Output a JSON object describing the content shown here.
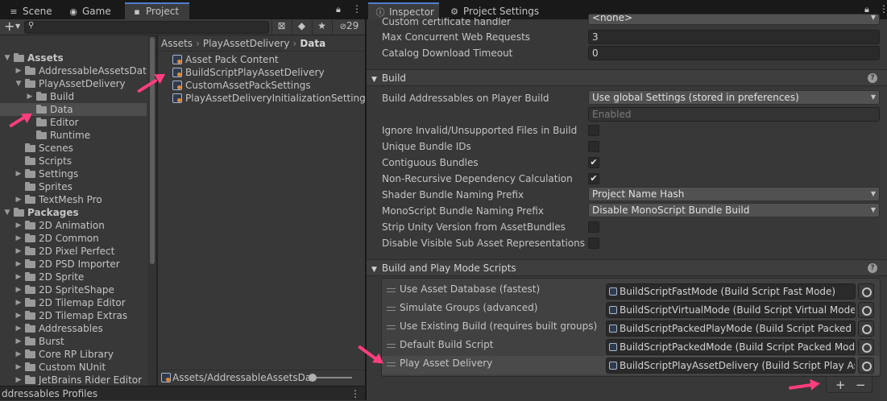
{
  "left_tabs": [
    {
      "label": "Scene",
      "icon": "scene-icon"
    },
    {
      "label": "Game",
      "icon": "game-icon"
    },
    {
      "label": "Project",
      "icon": "project-icon"
    }
  ],
  "right_tabs": [
    {
      "label": "Inspector",
      "icon": "info-icon"
    },
    {
      "label": "Project Settings",
      "icon": "gear-icon"
    }
  ],
  "toolbar": {
    "add_label": "+",
    "search_placeholder": "",
    "hidden_count": "29"
  },
  "tree": {
    "items": [
      {
        "label": "Assets",
        "level": 0,
        "expanded": true,
        "bold": true
      },
      {
        "label": "AddressableAssetsData",
        "level": 1,
        "expanded": false
      },
      {
        "label": "PlayAssetDelivery",
        "level": 1,
        "expanded": true
      },
      {
        "label": "Build",
        "level": 2,
        "expanded": false
      },
      {
        "label": "Data",
        "level": 2,
        "selected": true
      },
      {
        "label": "Editor",
        "level": 2
      },
      {
        "label": "Runtime",
        "level": 2
      },
      {
        "label": "Scenes",
        "level": 1
      },
      {
        "label": "Scripts",
        "level": 1
      },
      {
        "label": "Settings",
        "level": 1,
        "expanded": false
      },
      {
        "label": "Sprites",
        "level": 1
      },
      {
        "label": "TextMesh Pro",
        "level": 1,
        "expanded": false
      },
      {
        "label": "Packages",
        "level": 0,
        "expanded": true,
        "bold": true
      },
      {
        "label": "2D Animation",
        "level": 1,
        "expanded": false
      },
      {
        "label": "2D Common",
        "level": 1,
        "expanded": false
      },
      {
        "label": "2D Pixel Perfect",
        "level": 1,
        "expanded": false
      },
      {
        "label": "2D PSD Importer",
        "level": 1,
        "expanded": false
      },
      {
        "label": "2D Sprite",
        "level": 1,
        "expanded": false
      },
      {
        "label": "2D SpriteShape",
        "level": 1,
        "expanded": false
      },
      {
        "label": "2D Tilemap Editor",
        "level": 1,
        "expanded": false
      },
      {
        "label": "2D Tilemap Extras",
        "level": 1,
        "expanded": false
      },
      {
        "label": "Addressables",
        "level": 1,
        "expanded": false
      },
      {
        "label": "Burst",
        "level": 1,
        "expanded": false
      },
      {
        "label": "Core RP Library",
        "level": 1,
        "expanded": false
      },
      {
        "label": "Custom NUnit",
        "level": 1,
        "expanded": false
      },
      {
        "label": "JetBrains Rider Editor",
        "level": 1,
        "expanded": false
      }
    ]
  },
  "breadcrumb": {
    "items": [
      "Assets",
      "PlayAssetDelivery",
      "Data"
    ]
  },
  "assets": [
    "Asset Pack Content",
    "BuildScriptPlayAssetDelivery",
    "CustomAssetPackSettings",
    "PlayAssetDeliveryInitializationSettings"
  ],
  "footer_path": "Assets/AddressableAssetsDa",
  "bottom_panel_title": "ddressables Profiles",
  "inspector": {
    "top_props": [
      {
        "label": "Custom certificate handler",
        "value": "<none>",
        "kind": "dropdown"
      },
      {
        "label": "Max Concurrent Web Requests",
        "value": "3",
        "kind": "field"
      },
      {
        "label": "Catalog Download Timeout",
        "value": "0",
        "kind": "field"
      }
    ],
    "build_section": {
      "title": "Build",
      "props": [
        {
          "label": "Build Addressables on Player Build",
          "value": "Use global Settings (stored in preferences)",
          "kind": "dropdown"
        },
        {
          "label": "",
          "value": "Enabled",
          "kind": "disabled"
        },
        {
          "label": "Ignore Invalid/Unsupported Files in Build",
          "kind": "check",
          "checked": false
        },
        {
          "label": "Unique Bundle IDs",
          "kind": "check",
          "checked": false
        },
        {
          "label": "Contiguous Bundles",
          "kind": "check",
          "checked": true
        },
        {
          "label": "Non-Recursive Dependency Calculation",
          "kind": "check",
          "checked": true
        },
        {
          "label": "Shader Bundle Naming Prefix",
          "value": "Project Name Hash",
          "kind": "dropdown"
        },
        {
          "label": "MonoScript Bundle Naming Prefix",
          "value": "Disable MonoScript Bundle Build",
          "kind": "dropdown"
        },
        {
          "label": "Strip Unity Version from AssetBundles",
          "kind": "check",
          "checked": false
        },
        {
          "label": "Disable Visible Sub Asset Representations",
          "kind": "check",
          "checked": false
        }
      ]
    },
    "scripts_section": {
      "title": "Build and Play Mode Scripts",
      "rows": [
        {
          "name": "Use Asset Database (fastest)",
          "object": "BuildScriptFastMode (Build Script Fast Mode)"
        },
        {
          "name": "Simulate Groups (advanced)",
          "object": "BuildScriptVirtualMode (Build Script Virtual Mode)"
        },
        {
          "name": "Use Existing Build (requires built groups)",
          "object": "BuildScriptPackedPlayMode (Build Script Packed Pla"
        },
        {
          "name": "Default Build Script",
          "object": "BuildScriptPackedMode (Build Script Packed Mode)"
        },
        {
          "name": "Play Asset Delivery",
          "object": "BuildScriptPlayAssetDelivery (Build Script Play Asset",
          "selected": true
        }
      ],
      "add_label": "+",
      "remove_label": "−"
    }
  },
  "colors": {
    "annotation_arrow": "#ff3d7f",
    "active_tab_accent": "#4f7fd0"
  }
}
